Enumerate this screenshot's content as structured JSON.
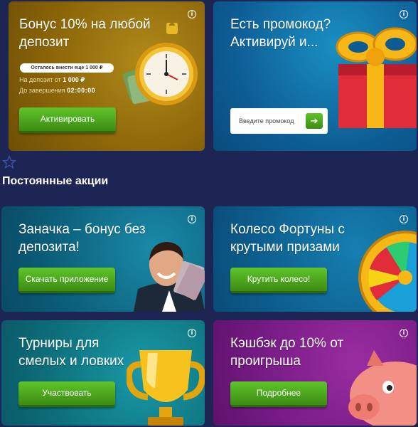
{
  "bonus": {
    "title": "Бонус 10% на любой депозит",
    "remaining": "Осталось внести еще 1 000 ₽",
    "deposit_label": "На депозит от",
    "deposit_value": "1 000 ₽",
    "time_label": "До завершения",
    "time_value": "02:00:00",
    "button": "Активировать"
  },
  "promo": {
    "title": "Есть промокод? Активируй и...",
    "placeholder": "Введите промокод",
    "go_icon": "arrow-right-icon"
  },
  "section": {
    "title": "Постоянные акции"
  },
  "stash": {
    "title": "Заначка – бонус без депозита!",
    "button": "Скачать приложение"
  },
  "wheel": {
    "title": "Колесо Фортуны с крутыми призами",
    "button": "Крутить колесо!"
  },
  "tournaments": {
    "title": "Турниры для смелых и ловких",
    "button": "Участвовать"
  },
  "cashback": {
    "title": "Кэшбэк до 10% от проигрыша",
    "button": "Подробнее"
  },
  "info_glyph": "i",
  "colors": {
    "page_bg": "#1d2555",
    "button_green": "#4aa61e",
    "bonus_card": "#8a6408",
    "promo_card": "#0d5c94",
    "stash_card": "#0b5d78",
    "wheel_card": "#0c5d8d",
    "tournaments_card": "#0d6e7a",
    "cashback_card": "#741a83"
  }
}
